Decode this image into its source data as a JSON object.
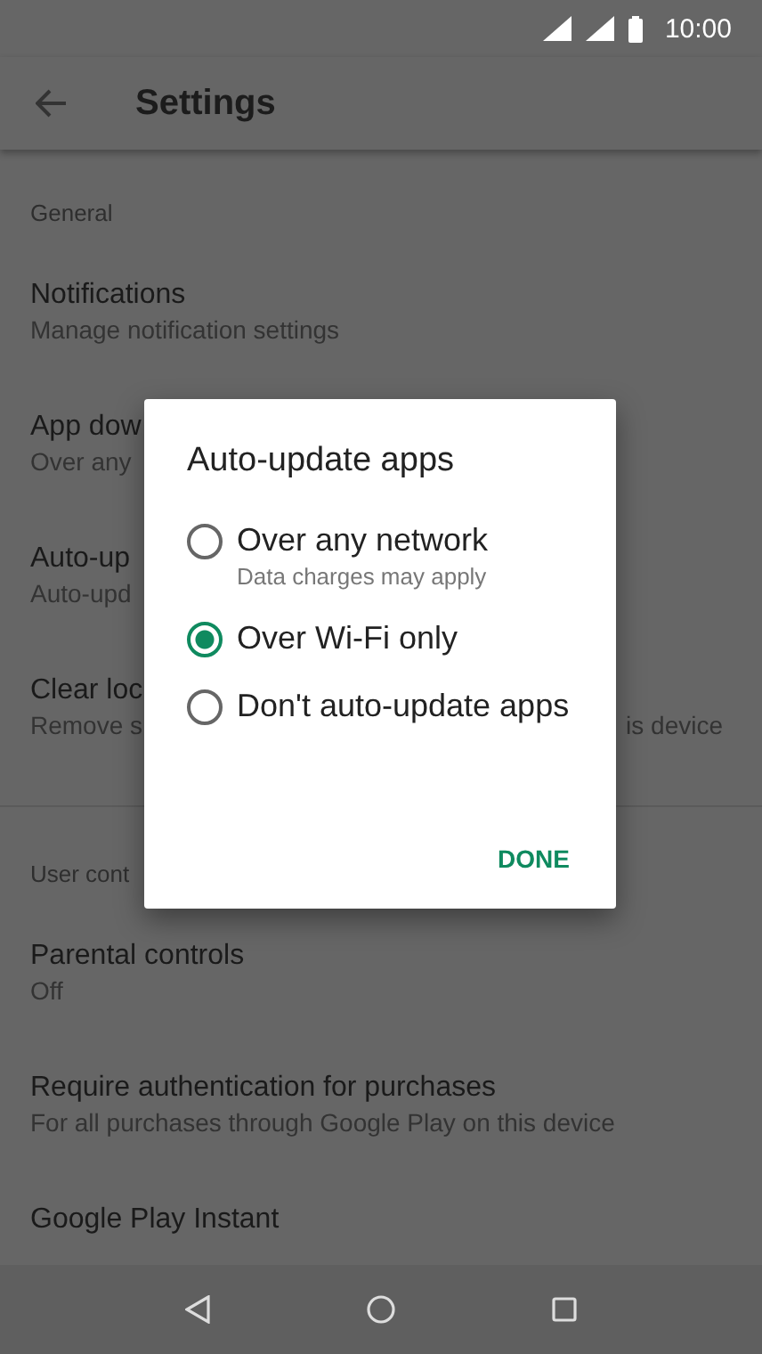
{
  "status_bar": {
    "time": "10:00"
  },
  "app_bar": {
    "title": "Settings"
  },
  "sections": [
    {
      "header": "General",
      "items": [
        {
          "title": "Notifications",
          "subtitle": "Manage notification settings"
        },
        {
          "title": "App dow",
          "subtitle": "Over any"
        },
        {
          "title": "Auto-up",
          "subtitle": "Auto-upd"
        },
        {
          "title": "Clear loc",
          "subtitle": "Remove s",
          "subtitle_end": "is device"
        }
      ]
    },
    {
      "header": "User cont",
      "items": [
        {
          "title": "Parental controls",
          "subtitle": "Off"
        },
        {
          "title": "Require authentication for purchases",
          "subtitle": "For all purchases through Google Play on this device"
        },
        {
          "title": "Google Play Instant"
        }
      ]
    }
  ],
  "dialog": {
    "title": "Auto-update apps",
    "options": [
      {
        "label": "Over any network",
        "subtitle": "Data charges may apply",
        "selected": false
      },
      {
        "label": "Over Wi-Fi only",
        "selected": true
      },
      {
        "label": "Don't auto-update apps",
        "selected": false
      }
    ],
    "button": "DONE"
  }
}
